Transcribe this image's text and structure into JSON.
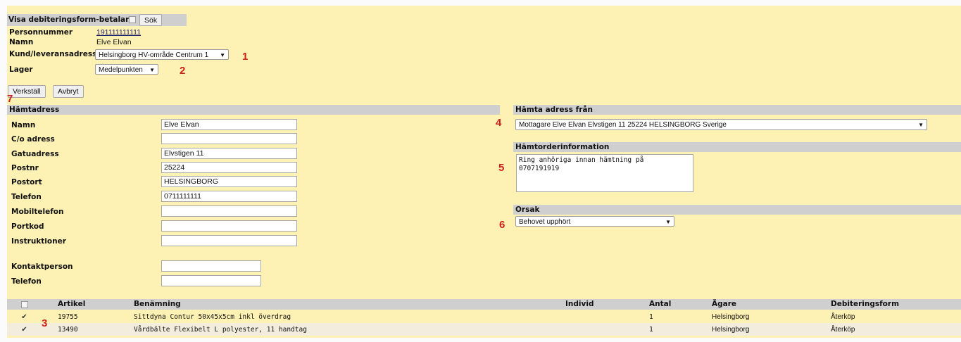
{
  "top": {
    "title": "Visa debiteringsform-betalare",
    "search_button": "Sök"
  },
  "customer": {
    "personnummer_label": "Personnummer",
    "personnummer": "191111111111",
    "namn_label": "Namn",
    "namn": "Elve Elvan",
    "address_label": "Kund/leveransadress",
    "address_value": "Helsingborg HV-område Centrum 1",
    "lager_label": "Lager",
    "lager_value": "Medelpunkten"
  },
  "actions": {
    "apply": "Verkställ",
    "cancel": "Avbryt"
  },
  "markers": {
    "m1": "1",
    "m2": "2",
    "m3": "3",
    "m4": "4",
    "m5": "5",
    "m6": "6",
    "m7": "7"
  },
  "pickup": {
    "section_title": "Hämtadress",
    "fields": [
      {
        "label": "Namn",
        "value": "Elve Elvan"
      },
      {
        "label": "C/o adress",
        "value": ""
      },
      {
        "label": "Gatuadress",
        "value": "Elvstigen 11"
      },
      {
        "label": "Postnr",
        "value": "25224"
      },
      {
        "label": "Postort",
        "value": "HELSINGBORG"
      },
      {
        "label": "Telefon",
        "value": "0711111111"
      },
      {
        "label": "Mobiltelefon",
        "value": ""
      },
      {
        "label": "Portkod",
        "value": ""
      },
      {
        "label": "Instruktioner",
        "value": ""
      }
    ],
    "contact_label": "Kontaktperson",
    "contact_value": "",
    "contact_phone_label": "Telefon",
    "contact_phone_value": ""
  },
  "right": {
    "fetch_from_title": "Hämta adress från",
    "fetch_from_value": "Mottagare Elve Elvan Elvstigen 11 25224 HELSINGBORG Sverige",
    "order_info_title": "Hämtorderinformation",
    "order_info_text": "Ring anhöriga innan hämtning på\n0707191919",
    "reason_title": "Orsak",
    "reason_value": "Behovet upphört"
  },
  "table": {
    "headers": [
      "Artikel",
      "Benämning",
      "Individ",
      "Antal",
      "Ägare",
      "Debiteringsform"
    ],
    "rows": [
      {
        "checked": true,
        "artikel": "19755",
        "benamning": "Sittdyna Contur 50x45x5cm inkl överdrag",
        "individ": "",
        "antal": "1",
        "agare": "Helsingborg",
        "debiteringsform": "Återköp"
      },
      {
        "checked": true,
        "artikel": "13490",
        "benamning": "Vårdbälte Flexibelt L polyester, 11 handtag",
        "individ": "",
        "antal": "1",
        "agare": "Helsingborg",
        "debiteringsform": "Återköp"
      }
    ]
  },
  "colors": {
    "panel": "#fdf1b3",
    "header_bar": "#cfcfcf",
    "marker": "#d0201a"
  }
}
